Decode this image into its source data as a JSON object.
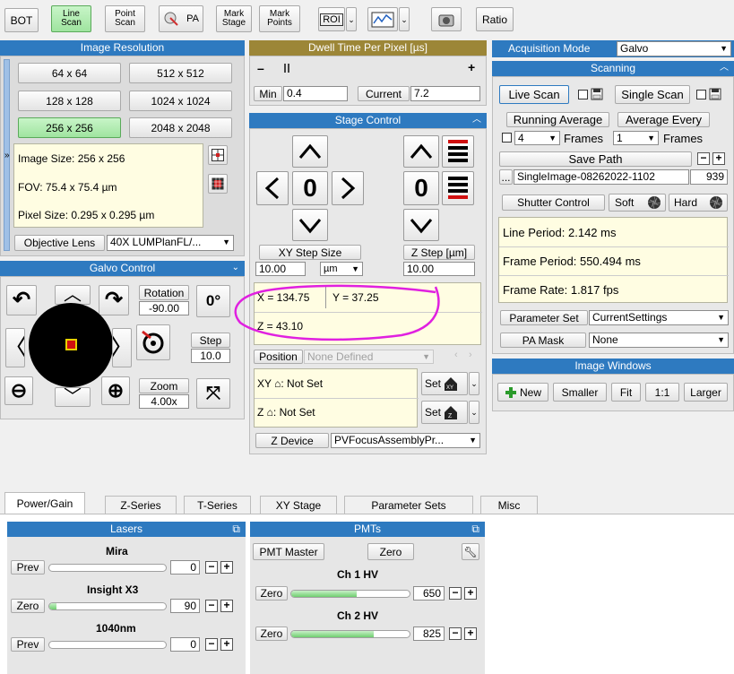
{
  "toolbar": {
    "bot": "BOT",
    "line_scan": [
      "Line",
      "Scan"
    ],
    "point_scan": [
      "Point",
      "Scan"
    ],
    "pa": "PA",
    "mark_stage": [
      "Mark",
      "Stage"
    ],
    "mark_points": [
      "Mark",
      "Points"
    ],
    "roi": "ROI",
    "ratio": "Ratio"
  },
  "image_resolution": {
    "title": "Image Resolution",
    "resolutions": [
      "64 x 64",
      "512 x 512",
      "128 x 128",
      "1024 x 1024",
      "256 x 256",
      "2048 x 2048"
    ],
    "selected": "256 x 256",
    "image_size": "Image Size: 256 x 256",
    "fov": "FOV: 75.4 x 75.4 µm",
    "pixel_size": "Pixel Size: 0.295 x 0.295 µm",
    "objective_label": "Objective Lens",
    "objective_value": "40X LUMPlanFL/..."
  },
  "dwell": {
    "title": "Dwell Time Per Pixel [µs]",
    "minus": "–",
    "plus": "+",
    "min_label": "Min",
    "min_value": "0.4",
    "current_label": "Current",
    "current_value": "7.2"
  },
  "stage_control": {
    "title": "Stage Control",
    "xy_zero": "0",
    "z_zero": "0",
    "xy_step_label": "XY Step Size",
    "xy_step_value": "10.00",
    "xy_step_unit": "µm",
    "z_step_label": "Z Step [µm]",
    "z_step_value": "10.00",
    "x": "X = 134.75",
    "y": "Y = 37.25",
    "z": "Z = 43.10",
    "position_label": "Position",
    "position_value": "None Defined",
    "xy_home": "XY ⌂:  Not Set",
    "z_home": "Z ⌂:  Not Set",
    "set_label": "Set",
    "z_device_label": "Z Device",
    "z_device_value": "PVFocusAssemblyPr..."
  },
  "galvo_control": {
    "title": "Galvo Control",
    "rotation_label": "Rotation",
    "rotation_value": "-90.00",
    "zero_deg": "0°",
    "step_label": "Step",
    "step_value": "10.0",
    "zoom_label": "Zoom",
    "zoom_value": "4.00x"
  },
  "acquisition": {
    "mode_label": "Acquisition Mode",
    "mode_value": "Galvo",
    "scanning_title": "Scanning",
    "live_scan": "Live Scan",
    "single_scan": "Single Scan",
    "running_average": "Running Average",
    "average_every": "Average Every",
    "frames_a": "4",
    "frames_b": "1",
    "frames_label": "Frames",
    "save_path": "Save Path",
    "save_name": "SingleImage-08262022-1102",
    "save_index": "939",
    "ellipsis": "...",
    "shutter_control": "Shutter Control",
    "soft": "Soft",
    "hard": "Hard",
    "line_period": "Line Period: 2.142 ms",
    "frame_period": "Frame Period: 550.494 ms",
    "frame_rate": "Frame Rate: 1.817 fps",
    "parameter_set_label": "Parameter Set",
    "parameter_set_value": "CurrentSettings",
    "pa_mask_label": "PA Mask",
    "pa_mask_value": "None"
  },
  "image_windows": {
    "title": "Image Windows",
    "new": "New",
    "smaller": "Smaller",
    "fit": "Fit",
    "one_to_one": "1:1",
    "larger": "Larger"
  },
  "tabs": [
    "Power/Gain",
    "Z-Series",
    "T-Series",
    "XY Stage",
    "Parameter Sets",
    "Misc"
  ],
  "lasers": {
    "title": "Lasers",
    "items": [
      {
        "name": "Mira",
        "button": "Prev",
        "value": "0",
        "level": 0
      },
      {
        "name": "Insight X3",
        "button": "Zero",
        "value": "90",
        "level": 0.06
      },
      {
        "name": "1040nm",
        "button": "Prev",
        "value": "0",
        "level": 0
      }
    ]
  },
  "pmts": {
    "title": "PMTs",
    "master": "PMT Master",
    "zero": "Zero",
    "channels": [
      {
        "name": "Ch 1 HV",
        "button": "Zero",
        "value": "650",
        "level": 0.55
      },
      {
        "name": "Ch 2 HV",
        "button": "Zero",
        "value": "825",
        "level": 0.7
      }
    ]
  },
  "colors": {
    "header_blue": "#2e7ac0",
    "header_gold": "#9c8637",
    "annotation_magenta": "#e020e0",
    "selected_green": "#9fe49f"
  }
}
